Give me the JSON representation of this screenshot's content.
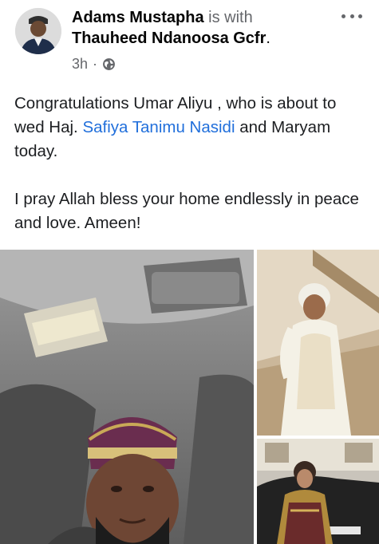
{
  "post": {
    "author": "Adams Mustapha",
    "with_text": "is with",
    "tagged": "Thauheed Ndanoosa Gcfr",
    "tagged_suffix": ".",
    "time": "3h",
    "separator": "·",
    "privacy_icon": "globe-icon",
    "more_icon": "more-options-icon",
    "text": {
      "line1_before": "Congratulations Umar Aliyu , who is about to wed Haj. ",
      "mention": "Safiya Tanimu Nasidi",
      "line1_after": " and Maryam today.",
      "paragraph2": "I pray Allah bless your home endlessly in peace and love. Ameen!"
    }
  },
  "colors": {
    "text": "#1c1e21",
    "secondary": "#65676b",
    "link": "#216fdb"
  },
  "photos": [
    {
      "description": "man-in-car-selfie"
    },
    {
      "description": "woman-in-white-dress"
    },
    {
      "description": "woman-by-car"
    }
  ]
}
